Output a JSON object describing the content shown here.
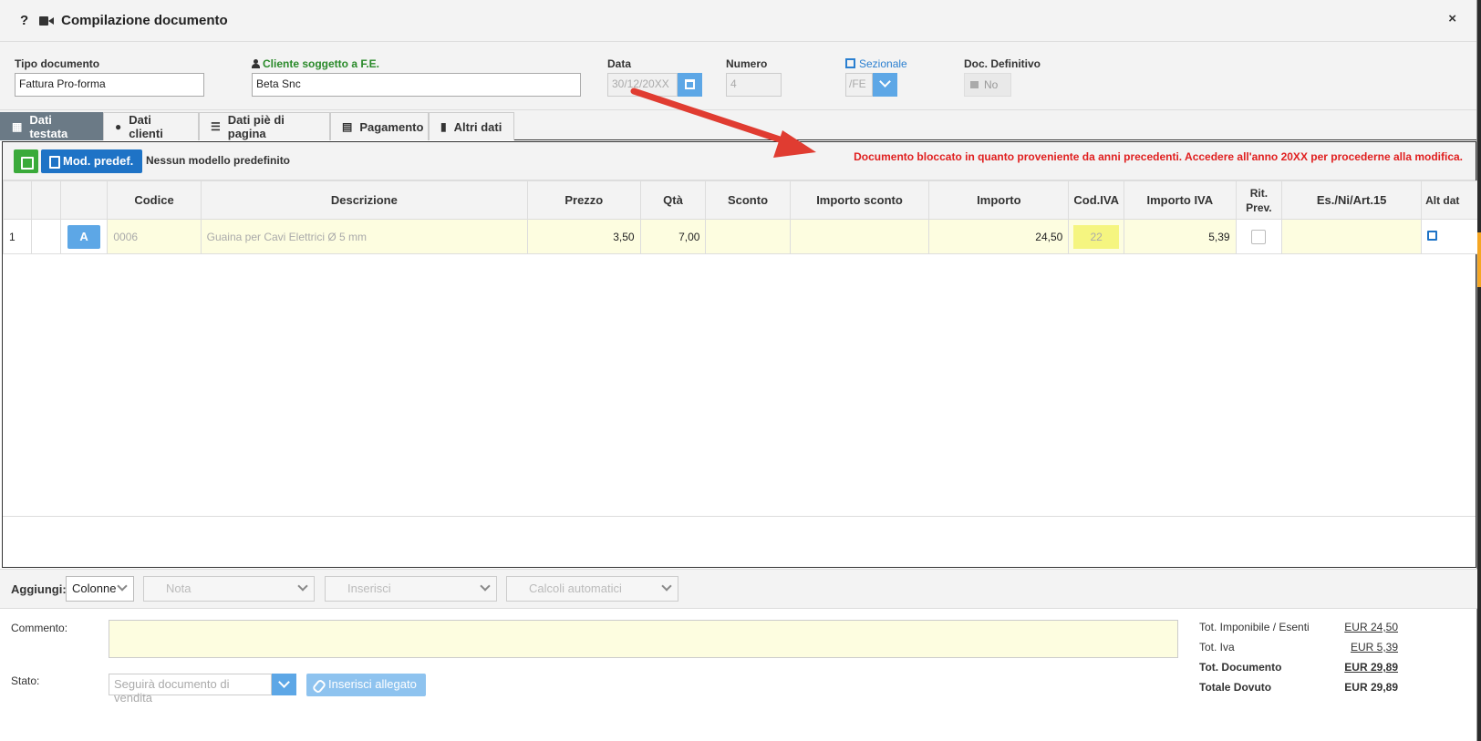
{
  "header": {
    "help": "?",
    "camera_icon": "video-camera-icon",
    "title": "Compilazione documento",
    "close": "×"
  },
  "fields": {
    "tipo_label": "Tipo documento",
    "tipo_value": "Fattura Pro-forma",
    "cliente_label": "Cliente soggetto a F.E.",
    "cliente_value": "Beta Snc",
    "data_label": "Data",
    "data_value": "30/12/20XX",
    "numero_label": "Numero",
    "numero_value": "4",
    "sezionale_label": "Sezionale",
    "sezionale_value": "/FE",
    "definitivo_label": "Doc. Definitivo",
    "definitivo_value": "No"
  },
  "tabs": [
    {
      "label": "Dati testata",
      "icon": "table-icon",
      "active": true
    },
    {
      "label": "Dati clienti",
      "icon": "user-icon"
    },
    {
      "label": "Dati piè di pagina",
      "icon": "list-icon"
    },
    {
      "label": "Pagamento",
      "icon": "calendar-icon"
    },
    {
      "label": "Altri dati",
      "icon": "file-icon"
    }
  ],
  "toolbar": {
    "model_button": "Mod. predef.",
    "model_text": "Nessun modello predefinito",
    "warning": "Documento bloccato in quanto proveniente da anni precedenti. Accedere all'anno 20XX per procederne alla modifica."
  },
  "grid": {
    "columns": [
      "",
      "",
      "",
      "Codice",
      "Descrizione",
      "Prezzo",
      "Qtà",
      "Sconto",
      "Importo sconto",
      "Importo",
      "Cod.IVA",
      "Importo IVA",
      "Rit. Prev.",
      "Es./Ni/Art.15",
      "Alt dat"
    ],
    "row": {
      "n": "1",
      "type": "A",
      "codice": "0006",
      "descrizione": "Guaina per Cavi Elettrici Ø 5 mm",
      "prezzo": "3,50",
      "qta": "7,00",
      "sconto": "",
      "importo_sconto": "",
      "importo": "24,50",
      "cod_iva": "22",
      "importo_iva": "5,39"
    }
  },
  "addbar": {
    "label": "Aggiungi:",
    "colonne": "Colonne",
    "nota": "Nota",
    "inserisci": "Inserisci",
    "calcoli": "Calcoli automatici"
  },
  "footer": {
    "commento_label": "Commento:",
    "stato_label": "Stato:",
    "stato_placeholder": "Seguirà documento di vendita",
    "allegato": "Inserisci allegato",
    "tot_imponibile_label": "Tot. Imponibile / Esenti",
    "tot_imponibile": "EUR 24,50",
    "tot_iva_label": "Tot. Iva",
    "tot_iva": "EUR 5,39",
    "tot_documento_label": "Tot. Documento",
    "tot_documento": "EUR 29,89",
    "totale_dovuto_label": "Totale Dovuto",
    "totale_dovuto": "EUR 29,89"
  },
  "colors": {
    "accent": "#1e73c6",
    "warning": "#e02020",
    "arrow": "#e03c31",
    "tab_active": "#6b7a86"
  }
}
